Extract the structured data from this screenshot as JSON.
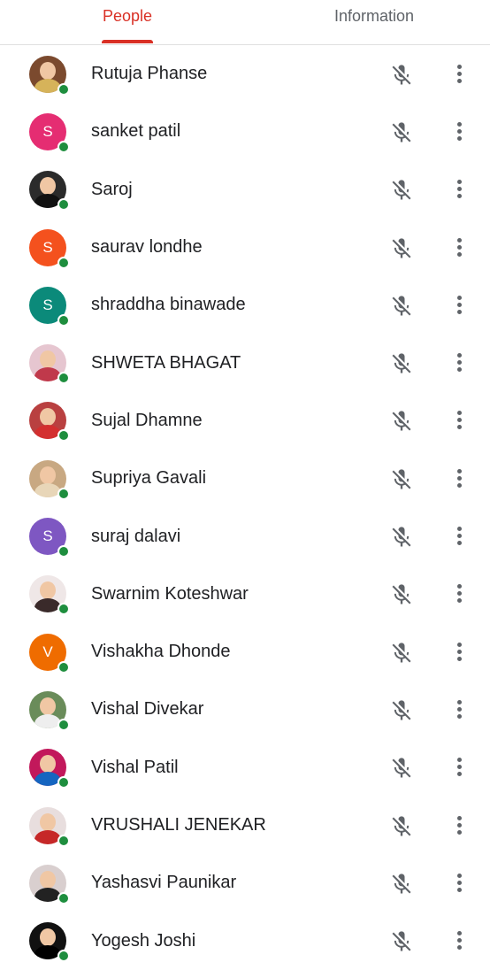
{
  "tabs": {
    "people": "People",
    "information": "Information"
  },
  "participants": [
    {
      "name": "Rutuja Phanse",
      "avatar_type": "photo",
      "photo_bg": "#7b4a2e",
      "photo_body": "#d6b35a"
    },
    {
      "name": "sanket patil",
      "avatar_type": "letter",
      "initial": "S",
      "color": "#e52d72"
    },
    {
      "name": "Saroj",
      "avatar_type": "photo",
      "photo_bg": "#2b2b2b",
      "photo_body": "#111111"
    },
    {
      "name": "saurav londhe",
      "avatar_type": "letter",
      "initial": "S",
      "color": "#f4511e"
    },
    {
      "name": "shraddha binawade",
      "avatar_type": "letter",
      "initial": "S",
      "color": "#0b8a7a"
    },
    {
      "name": "SHWETA BHAGAT",
      "avatar_type": "photo",
      "photo_bg": "#e6c6d0",
      "photo_body": "#c0394b"
    },
    {
      "name": "Sujal Dhamne",
      "avatar_type": "photo",
      "photo_bg": "#b94040",
      "photo_body": "#d32f2f"
    },
    {
      "name": "Supriya Gavali",
      "avatar_type": "photo",
      "photo_bg": "#c8a882",
      "photo_body": "#e8d6b8"
    },
    {
      "name": "suraj dalavi",
      "avatar_type": "letter",
      "initial": "S",
      "color": "#7e57c2"
    },
    {
      "name": "Swarnim Koteshwar",
      "avatar_type": "photo",
      "photo_bg": "#efe7e7",
      "photo_body": "#3a2a2a"
    },
    {
      "name": "Vishakha Dhonde",
      "avatar_type": "letter",
      "initial": "V",
      "color": "#ef6c00"
    },
    {
      "name": "Vishal Divekar",
      "avatar_type": "photo",
      "photo_bg": "#6a8c5a",
      "photo_body": "#eeeeee"
    },
    {
      "name": "Vishal Patil",
      "avatar_type": "photo",
      "photo_bg": "#c2185b",
      "photo_body": "#1565c0"
    },
    {
      "name": "VRUSHALI JENEKAR",
      "avatar_type": "photo",
      "photo_bg": "#e8dede",
      "photo_body": "#c62828"
    },
    {
      "name": "Yashasvi Paunikar",
      "avatar_type": "photo",
      "photo_bg": "#d9cfcf",
      "photo_body": "#222222"
    },
    {
      "name": "Yogesh Joshi",
      "avatar_type": "photo",
      "photo_bg": "#111111",
      "photo_body": "#000000"
    }
  ],
  "icons": {
    "mic": "mic-off-icon",
    "menu": "more-vert-icon",
    "online": "online-status-icon"
  },
  "colors": {
    "accent": "#d93025",
    "online": "#1e8e3e",
    "icon_gray": "#5f6368"
  }
}
